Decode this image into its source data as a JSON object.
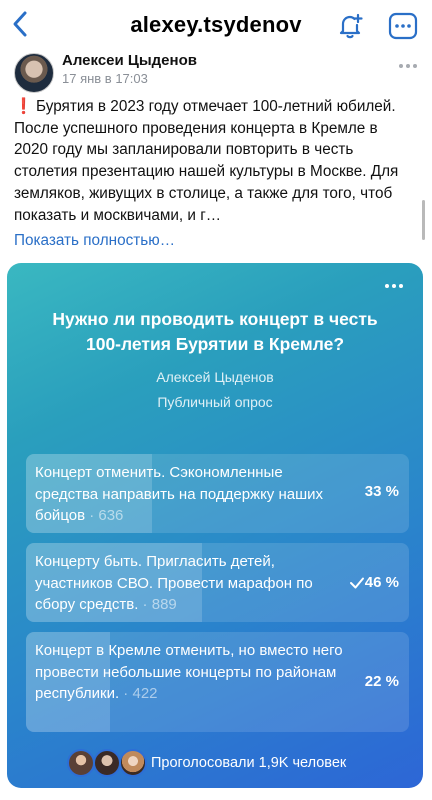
{
  "header": {
    "title": "alexey.tsydenov",
    "back_icon": "chevron-left-icon",
    "bell_icon": "bell-plus-icon",
    "more_icon": "more-horizontal-icon",
    "accent": "#2a6fc7"
  },
  "post": {
    "author": "Алексеи Цыденов",
    "time": "17 янв в 17:03",
    "exclamation": "❗",
    "text": "Бурятия в 2023 году отмечает 100-летний юбилей. После успешного проведения концерта в Кремле в 2020 году мы запланировали повторить в честь столетия презентацию нашей культуры в Москве. Для земляков, живущих в столице, а также для того, чтоб показать и москвичами, и г…",
    "show_more": "Показать полностью…"
  },
  "poll": {
    "question": "Нужно ли проводить концерт в честь 100-летия Бурятии в Кремле?",
    "author": "Алексей Цыденов",
    "type": "Публичный опрос",
    "options": [
      {
        "text": "Концерт отменить. Сэкономленные средства направить на поддержку наших бойцов",
        "votes": " · 636",
        "percent": "33 %",
        "fraction": 0.33,
        "checked": false
      },
      {
        "text": "Концерту быть. Пригласить детей, участников СВО. Провести марафон по сбору средств.",
        "votes": " · 889",
        "percent": "46 %",
        "fraction": 0.46,
        "checked": true
      },
      {
        "text": "Концерт в Кремле отменить, но вместо него провести небольшие концерты по районам республики.",
        "votes": " · 422",
        "percent": "22 %",
        "fraction": 0.22,
        "checked": false
      }
    ],
    "voted_text": "Проголосовали 1,9K человек",
    "colors": {
      "gradient_start": "#3ab8c1",
      "gradient_end": "#2d66d6"
    }
  }
}
